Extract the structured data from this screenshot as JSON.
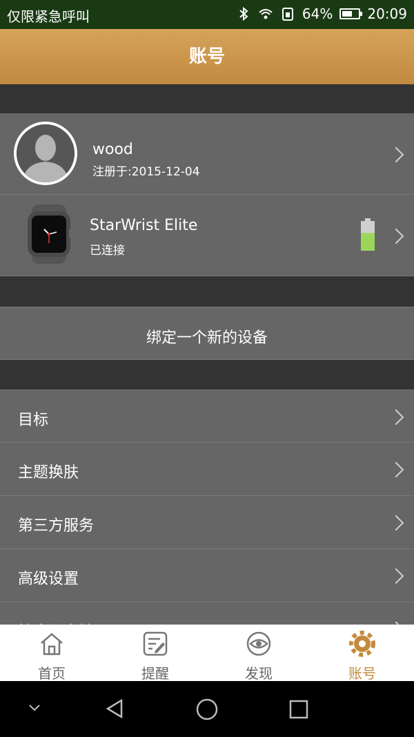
{
  "status_bar": {
    "emergency_text": "仅限紧急呼叫",
    "battery_percent": "64%",
    "battery_level": 0.64,
    "time": "20:09",
    "icons": [
      "bluetooth-icon",
      "wifi-icon",
      "sim-icon",
      "battery-icon"
    ]
  },
  "header": {
    "title": "账号"
  },
  "profile": {
    "username": "wood",
    "registered": "注册于:2015-12-04"
  },
  "device": {
    "name": "StarWrist Elite",
    "status": "已连接",
    "battery_level": 0.6,
    "battery_color": "#9bd65a"
  },
  "bind_button": {
    "label": "绑定一个新的设备"
  },
  "menu": [
    {
      "label": "目标"
    },
    {
      "label": "主题换肤"
    },
    {
      "label": "第三方服务"
    },
    {
      "label": "高级设置"
    },
    {
      "label": "技术与支持"
    }
  ],
  "tabs": [
    {
      "label": "首页",
      "icon": "home-icon"
    },
    {
      "label": "提醒",
      "icon": "reminder-icon"
    },
    {
      "label": "发现",
      "icon": "eye-icon"
    },
    {
      "label": "账号",
      "icon": "gear-icon",
      "active": true
    }
  ],
  "colors": {
    "accent": "#c48a3a",
    "header": "#c9924a",
    "row_bg": "#666666",
    "gap_bg": "#333333"
  }
}
